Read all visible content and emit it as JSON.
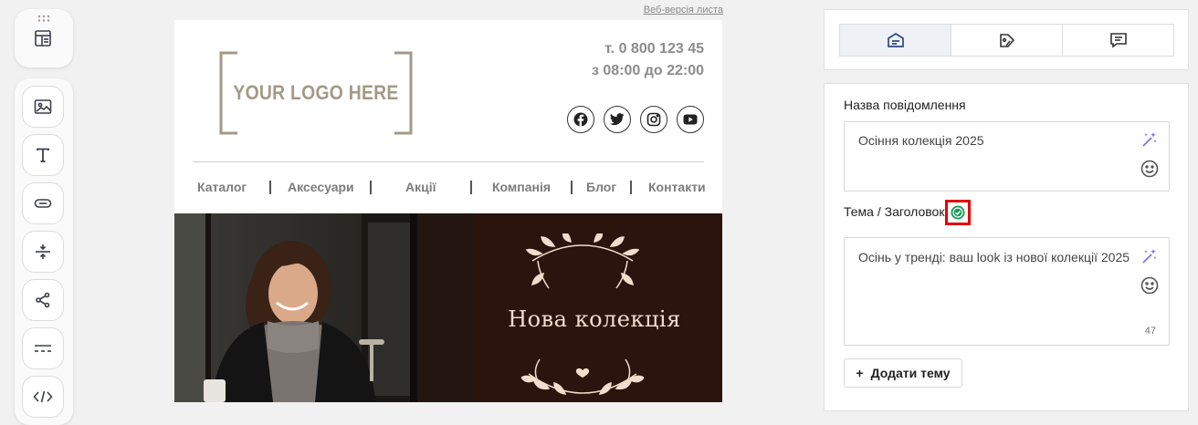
{
  "toolbar": {
    "drag_handle_icon": "drag-dots-icon",
    "layout_icon": "layout-blocks-icon",
    "tools": [
      {
        "name": "image-block",
        "icon": "image-icon"
      },
      {
        "name": "text-block",
        "icon": "text-icon"
      },
      {
        "name": "button-block",
        "icon": "button-icon"
      },
      {
        "name": "spacer-block",
        "icon": "spacer-icon"
      },
      {
        "name": "social-block",
        "icon": "share-icon"
      },
      {
        "name": "divider-block",
        "icon": "divider-icon"
      },
      {
        "name": "html-block",
        "icon": "code-icon"
      }
    ]
  },
  "email": {
    "web_version_link": "Веб-версія листа",
    "logo_text": "YOUR LOGO HERE",
    "phone": "т. 0 800 123 45",
    "hours": "з 08:00 до 22:00",
    "socials": [
      "facebook-icon",
      "twitter-icon",
      "instagram-icon",
      "youtube-icon"
    ],
    "menu": [
      "Каталог",
      "Аксесуари",
      "Акції",
      "Компанія",
      "Блог",
      "Контакти"
    ],
    "hero_title": "Нова колекція"
  },
  "panel": {
    "tabs": [
      {
        "icon": "mail-settings-icon",
        "active": true
      },
      {
        "icon": "tag-icon",
        "active": false
      },
      {
        "icon": "comment-icon",
        "active": false
      }
    ],
    "message_name_label": "Назва повідомлення",
    "message_name_value": "Осіння колекція 2025",
    "subject_label": "Тема / Заголовок",
    "subject_value": "Осінь у тренді: ваш look із нової колекції 2025",
    "subject_counter": "47",
    "add_subject_button": "Додати тему",
    "colors": {
      "accent": "#2f4a7c",
      "ai": "#7b6ff0",
      "check": "#1a9a5c",
      "highlight": "#e10600"
    }
  }
}
